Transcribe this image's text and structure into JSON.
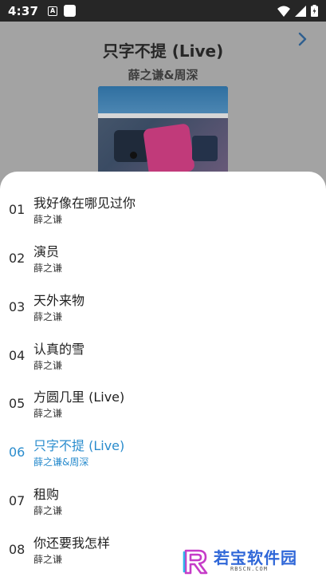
{
  "status_bar": {
    "time": "4:37",
    "notif_label": "A"
  },
  "player": {
    "title": "只字不提 (Live)",
    "artist": "薛之谦&周深"
  },
  "playlist": {
    "tracks": [
      {
        "num": "01",
        "title": "我好像在哪见过你",
        "artist": "薛之谦",
        "active": false
      },
      {
        "num": "02",
        "title": "演员",
        "artist": "薛之谦",
        "active": false
      },
      {
        "num": "03",
        "title": "天外来物",
        "artist": "薛之谦",
        "active": false
      },
      {
        "num": "04",
        "title": "认真的雪",
        "artist": "薛之谦",
        "active": false
      },
      {
        "num": "05",
        "title": "方圆几里 (Live)",
        "artist": "薛之谦",
        "active": false
      },
      {
        "num": "06",
        "title": "只字不提 (Live)",
        "artist": "薛之谦&周深",
        "active": true
      },
      {
        "num": "07",
        "title": "租购",
        "artist": "薛之谦",
        "active": false
      },
      {
        "num": "08",
        "title": "你还要我怎样",
        "artist": "薛之谦",
        "active": false
      }
    ]
  },
  "watermark": {
    "name": "若宝软件园",
    "url": "RBSCN.COM"
  },
  "colors": {
    "accent": "#2a8ccd",
    "status_bar": "#262626",
    "dim_overlay": "#a3a3a3"
  }
}
